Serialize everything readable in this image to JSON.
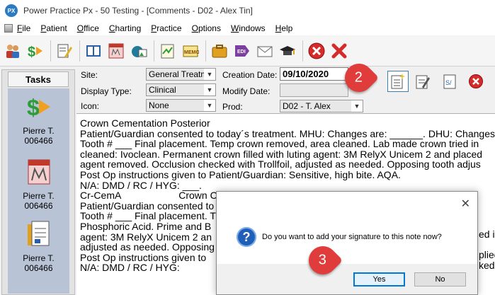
{
  "window": {
    "app_logo": "PX",
    "title": "Power Practice Px - 50 Testing - [Comments - D02 - Alex Tin]"
  },
  "menu": [
    "File",
    "Patient",
    "Office",
    "Charting",
    "Practice",
    "Options",
    "Windows",
    "Help"
  ],
  "toolbar_icons": [
    "patients-icon",
    "money-icon",
    "pencil-list-icon",
    "ledger-book-icon",
    "chart-icon",
    "camera-image-icon",
    "notepad-icon",
    "memo-icon",
    "briefcase-icon",
    "edi-icon",
    "envelope-icon",
    "graduation-cap-icon",
    "cancel-icon",
    "close-x-icon"
  ],
  "tasks": {
    "title": "Tasks",
    "items": [
      {
        "icon": "money-icon",
        "name": "Pierre T.",
        "id": "006466"
      },
      {
        "icon": "chart-icon",
        "name": "Pierre T.",
        "id": "006466"
      },
      {
        "icon": "document-icon",
        "name": "Pierre T.",
        "id": "006466"
      }
    ]
  },
  "form": {
    "site_label": "Site:",
    "site_value": "General Treatm",
    "display_type_label": "Display Type:",
    "display_type_value": "Clinical",
    "icon_label": "Icon:",
    "icon_value": "None",
    "creation_date_label": "Creation Date:",
    "creation_date_value": "09/10/2020",
    "modify_date_label": "Modify Date:",
    "modify_date_value": "",
    "prod_label": "Prod:",
    "prod_value": "D02 - T. Alex"
  },
  "note_lines": [
    "Crown Cementation Posterior",
    "Patient/Guardian consented to today´s treatment. MHU: Changes are: ______. DHU: Changes",
    "Tooth # ___ Final placement. Temp crown removed, area cleaned. Lab made crown tried in",
    "cleaned: Ivoclean. Permanent crown filled with luting agent: 3M RelyX Unicem 2 and placed",
    "agent removed. Occlusion checked with Trollfoil, adjusted as needed. Opposing tooth adjus",
    "Post Op instructions given to Patient/Guardian: Sensitive, high bite. AQA.",
    "N/A: DMD / RC / HYG: ___.",
    "",
    "Cr-CemA                     Crown C",
    "Patient/Guardian consented to t",
    "Tooth # ___ Final placement. T",
    "Phosphoric Acid. Prime and B",
    "agent: 3M RelyX Unicem 2 an",
    "adjusted as needed. Opposing",
    "Post Op instructions given to",
    "N/A: DMD / RC / HYG:"
  ],
  "note_tail": [
    "ed in",
    "",
    "plied",
    "ked r",
    "",
    ""
  ],
  "callouts": {
    "first": "2",
    "second": "3"
  },
  "dialog": {
    "close": "✕",
    "message": "Do you want to add your signature to this note now?",
    "yes_label": "Yes",
    "no_label": "No"
  },
  "colors": {
    "accent": "#e13c3c",
    "selection": "#b9c3d6",
    "dialog_default": "#0078d7"
  }
}
